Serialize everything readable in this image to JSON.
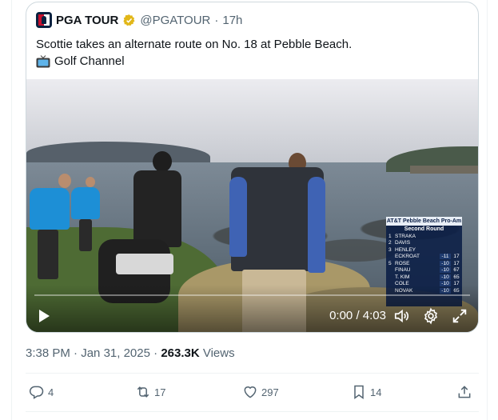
{
  "quoted_post": {
    "display_name": "PGA TOUR",
    "handle": "@PGATOUR",
    "separator": "·",
    "time": "17h",
    "text": "Scottie takes an alternate route on No. 18 at Pebble Beach.",
    "channel": "Golf Channel",
    "icons": {
      "avatar": "pga-tour-logo",
      "verified": "verified-badge-gold",
      "channel": "tv-emoji"
    }
  },
  "video": {
    "current_time": "0:00",
    "divider": "/",
    "duration": "4:03",
    "progress": 0,
    "scoreboard": {
      "title": "AT&T Pebble Beach Pro-Am",
      "round": "Second Round",
      "rows": [
        {
          "pos": "1",
          "name": "STRAKA",
          "score": "",
          "holes": ""
        },
        {
          "pos": "2",
          "name": "DAVIS",
          "score": "",
          "holes": ""
        },
        {
          "pos": "3",
          "name": "HENLEY",
          "score": "",
          "holes": ""
        },
        {
          "pos": "",
          "name": "ECKROAT",
          "score": "-11",
          "holes": "17"
        },
        {
          "pos": "5",
          "name": "ROSE",
          "score": "-10",
          "holes": "17"
        },
        {
          "pos": "",
          "name": "FINAU",
          "score": "-10",
          "holes": "67"
        },
        {
          "pos": "",
          "name": "T. KIM",
          "score": "-10",
          "holes": "65"
        },
        {
          "pos": "",
          "name": "COLE",
          "score": "-10",
          "holes": "17"
        },
        {
          "pos": "",
          "name": "NOVAK",
          "score": "-10",
          "holes": "65"
        }
      ]
    },
    "icons": {
      "play": "play-icon",
      "volume": "volume-icon",
      "settings": "gear-icon",
      "fullscreen": "fullscreen-icon"
    }
  },
  "post_meta": {
    "time": "3:38 PM",
    "separator": "·",
    "date": "Jan 31, 2025",
    "views_count": "263.3K",
    "views_label": "Views"
  },
  "actions": {
    "replies": "4",
    "reposts": "17",
    "likes": "297",
    "bookmarks": "14",
    "icons": [
      "reply-icon",
      "repost-icon",
      "like-icon",
      "bookmark-icon",
      "share-icon"
    ]
  },
  "colors": {
    "accent": "#1d9bf0",
    "muted_text": "#536471",
    "border": "#cfd9de",
    "verified": "#e2b719",
    "repost_icon": "#536471"
  }
}
